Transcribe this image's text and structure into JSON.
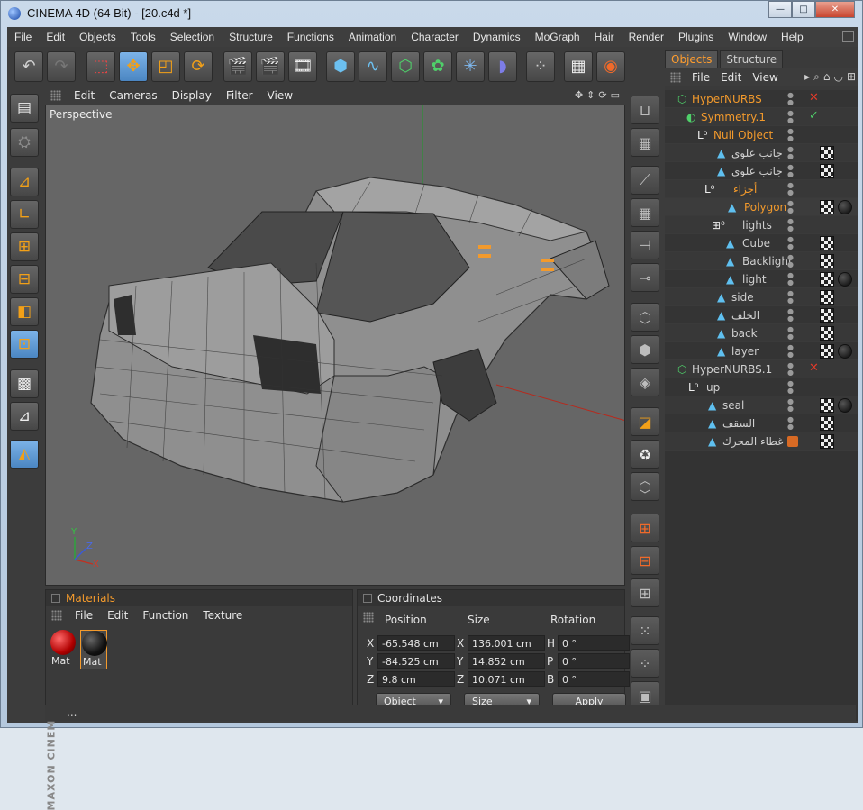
{
  "window": {
    "title": "CINEMA 4D (64 Bit) - [20.c4d *]",
    "minimize": "—",
    "maximize": "□",
    "close": "✕"
  },
  "menubar": [
    "File",
    "Edit",
    "Objects",
    "Tools",
    "Selection",
    "Structure",
    "Functions",
    "Animation",
    "Character",
    "Dynamics",
    "MoGraph",
    "Hair",
    "Render",
    "Plugins",
    "Window",
    "Help"
  ],
  "viewport": {
    "menu": [
      "Edit",
      "Cameras",
      "Display",
      "Filter",
      "View"
    ],
    "label": "Perspective",
    "axis": {
      "x": "X",
      "y": "Y",
      "z": "Z"
    }
  },
  "object_manager": {
    "tabs": [
      "Objects",
      "Structure"
    ],
    "menu": [
      "File",
      "Edit",
      "View"
    ],
    "objects": [
      {
        "name": "HyperNURBS",
        "state": "✕"
      },
      {
        "name": "Symmetry.1",
        "state": "✓"
      },
      {
        "name": "Null Object"
      },
      {
        "name": "جانب علوي"
      },
      {
        "name": "جانب علوي"
      },
      {
        "name": "أجزاء"
      },
      {
        "name": "Polygon"
      },
      {
        "name": "lights"
      },
      {
        "name": "Cube"
      },
      {
        "name": "Backlight"
      },
      {
        "name": "light"
      },
      {
        "name": "side"
      },
      {
        "name": "الخلف"
      },
      {
        "name": "back"
      },
      {
        "name": "layer"
      },
      {
        "name": "HyperNURBS.1",
        "state": "✕"
      },
      {
        "name": "up"
      },
      {
        "name": "seal"
      },
      {
        "name": "السقف"
      },
      {
        "name": "غطاء المحرك"
      }
    ]
  },
  "materials": {
    "title": "Materials",
    "menu": [
      "File",
      "Edit",
      "Function",
      "Texture"
    ],
    "items": [
      {
        "label": "Mat",
        "color": "#e01010"
      },
      {
        "label": "Mat",
        "color": "#111111"
      }
    ]
  },
  "coordinates": {
    "title": "Coordinates",
    "headers": [
      "Position",
      "Size",
      "Rotation"
    ],
    "position": [
      {
        "axis": "X",
        "value": "-65.548 cm"
      },
      {
        "axis": "Y",
        "value": "-84.525 cm"
      },
      {
        "axis": "Z",
        "value": "9.8 cm"
      }
    ],
    "size": [
      {
        "axis": "X",
        "value": "136.001 cm"
      },
      {
        "axis": "Y",
        "value": "14.852 cm"
      },
      {
        "axis": "Z",
        "value": "10.071 cm"
      }
    ],
    "rotation": [
      {
        "axis": "H",
        "value": "0 °"
      },
      {
        "axis": "P",
        "value": "0 °"
      },
      {
        "axis": "B",
        "value": "0 °"
      }
    ],
    "mode_object": "Object",
    "mode_size": "Size",
    "apply": "Apply"
  },
  "status": "...",
  "brand": "MAXON CINEMA 4D",
  "colors": {
    "accent": "#f39a2c",
    "active_tool": "#5b93cf",
    "viewport_bg": "#666666"
  }
}
